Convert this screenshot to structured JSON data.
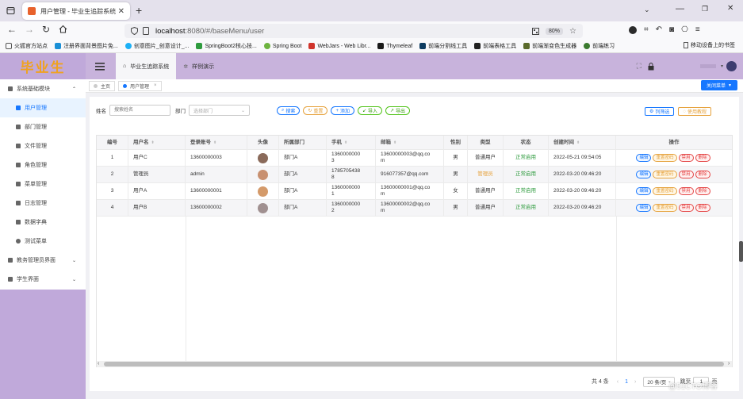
{
  "browser": {
    "tab_title": "用户管理 - 毕业生追踪系统",
    "url_host": "localhost",
    "url_rest": ":8080/#/baseMenu/user",
    "zoom": "80%",
    "bookmarks": [
      "火狐官方站点",
      "注册界面背景图片免...",
      "创意图片_创意设计_...",
      "SpringBoot2核心技...",
      "Spring Boot",
      "WebJars - Web Libr...",
      "Thymeleaf",
      "前端分割线工具",
      "前端表格工具",
      "前端渐变色生成器",
      "前端练习"
    ],
    "bookmark_other": "移动设备上的书签"
  },
  "app": {
    "logo": "毕业生",
    "header_tabs": [
      "毕业生追踪系统",
      "样例演示"
    ]
  },
  "sidebar": {
    "group": "系统基础模块",
    "items": [
      "用户管理",
      "部门管理",
      "文件管理",
      "角色管理",
      "菜单管理",
      "日志管理",
      "数据字典",
      "测试菜单"
    ],
    "others": [
      "教务管理员界面",
      "学生界面"
    ]
  },
  "tags": {
    "home": "主页",
    "current": "用户管理",
    "close_menu": "关闭菜单"
  },
  "search": {
    "name_label": "姓名",
    "name_placeholder": "搜索姓名",
    "dept_label": "部门",
    "dept_placeholder": "选择部门",
    "buttons": [
      "搜索",
      "重置",
      "添加",
      "导入",
      "导出"
    ],
    "right_buttons": [
      "列筛选",
      "使用教程"
    ]
  },
  "table": {
    "columns": [
      "编号",
      "用户名",
      "登录账号",
      "头像",
      "所属部门",
      "手机",
      "邮箱",
      "性别",
      "类型",
      "状态",
      "创建时间",
      "操作"
    ],
    "rows": [
      {
        "id": "1",
        "name": "用户C",
        "account": "13600000003",
        "dept": "部门A",
        "phone_a": "1360000000",
        "phone_b": "3",
        "email_a": "13600000003@qq.co",
        "email_b": "m",
        "gender": "男",
        "type": "普通用户",
        "status": "正常启用",
        "created": "2022-05-21 09:54:05"
      },
      {
        "id": "2",
        "name": "管理员",
        "account": "admin",
        "dept": "部门A",
        "phone_a": "1785705438",
        "phone_b": "8",
        "email_a": "916077357@qq.com",
        "email_b": "",
        "gender": "男",
        "type": "管理员",
        "status": "正常启用",
        "created": "2022-03-20 09:46:20"
      },
      {
        "id": "3",
        "name": "用户A",
        "account": "13600000001",
        "dept": "部门A",
        "phone_a": "1360000000",
        "phone_b": "1",
        "email_a": "13600000001@qq.co",
        "email_b": "m",
        "gender": "女",
        "type": "普通用户",
        "status": "正常启用",
        "created": "2022-03-20 09:46:20"
      },
      {
        "id": "4",
        "name": "用户B",
        "account": "13600000002",
        "dept": "部门A",
        "phone_a": "1360000000",
        "phone_b": "2",
        "email_a": "13600000002@qq.co",
        "email_b": "m",
        "gender": "男",
        "type": "普通用户",
        "status": "正常启用",
        "created": "2022-03-20 09:46:20"
      }
    ],
    "actions": [
      "编辑",
      "重置密码",
      "禁用",
      "删除"
    ]
  },
  "pager": {
    "total": "共 4 条",
    "page": "1",
    "size": "20 条/页",
    "goto": "跳至",
    "goto_value": "1",
    "page_unit": "页"
  },
  "watermark": "@51CTO博客"
}
